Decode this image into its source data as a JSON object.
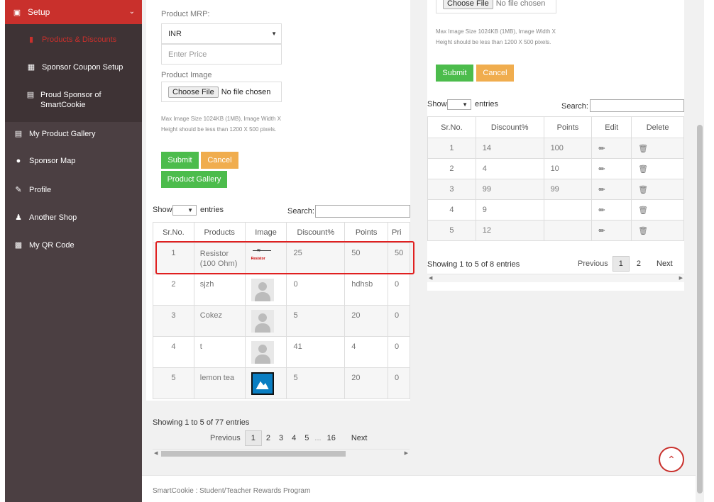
{
  "sidebar": {
    "setup": {
      "label": "Setup",
      "icon": "monitor-icon"
    },
    "submenu": [
      {
        "label": "Products & Discounts",
        "icon": "gift-icon",
        "active": true
      },
      {
        "label": "Sponsor Coupon Setup",
        "icon": "grid-icon",
        "active": false
      },
      {
        "label": "Proud Sponsor of SmartCookie",
        "icon": "picture-icon",
        "active": false
      }
    ],
    "items": [
      {
        "label": "My Product Gallery",
        "icon": "picture-icon"
      },
      {
        "label": "Sponsor Map",
        "icon": "map-marker-icon"
      },
      {
        "label": "Profile",
        "icon": "edit-icon"
      },
      {
        "label": "Another Shop",
        "icon": "users-icon"
      },
      {
        "label": "My QR Code",
        "icon": "qrcode-icon"
      }
    ]
  },
  "product_form": {
    "mrp_label": "Product MRP:",
    "currency": "INR",
    "price_placeholder": "Enter Price",
    "image_label": "Product Image",
    "choose_file": "Choose File",
    "no_file": "No file chosen",
    "hint": "Max Image Size 1024KB (1MB), Image Width X Height should be less than 1200 X 500 pixels.",
    "submit": "Submit",
    "cancel": "Cancel",
    "gallery": "Product Gallery"
  },
  "products_table": {
    "show": "Show",
    "entries": "entries",
    "search": "Search:",
    "columns": [
      "Sr.No.",
      "Products",
      "Image",
      "Discount%",
      "Points",
      "Pri"
    ],
    "rows": [
      {
        "sr": "1",
        "product": "Resistor (100 Ohm)",
        "image": "resistor",
        "image_caption": "Resistor",
        "discount": "25",
        "points": "50",
        "price": "50"
      },
      {
        "sr": "2",
        "product": "sjzh",
        "image": "placeholder",
        "discount": "0",
        "points": "hdhsb",
        "price": "0"
      },
      {
        "sr": "3",
        "product": "Cokez",
        "image": "placeholder",
        "discount": "5",
        "points": "20",
        "price": "0"
      },
      {
        "sr": "4",
        "product": "t",
        "image": "placeholder",
        "discount": "41",
        "points": "4",
        "price": "0"
      },
      {
        "sr": "5",
        "product": "lemon tea",
        "image": "tea",
        "discount": "5",
        "points": "20",
        "price": "0"
      }
    ],
    "info": "Showing 1 to 5 of 77 entries",
    "pagination": {
      "previous": "Previous",
      "pages": [
        "1",
        "2",
        "3",
        "4",
        "5"
      ],
      "ellipsis": "...",
      "last": "16",
      "next": "Next"
    }
  },
  "coupon_form": {
    "choose_file": "Choose File",
    "no_file": "No file chosen",
    "hint": "Max Image Size 1024KB (1MB), Image Width X Height should be less than 1200 X 500 pixels.",
    "submit": "Submit",
    "cancel": "Cancel"
  },
  "discount_table": {
    "show": "Show",
    "entries": "entries",
    "search": "Search:",
    "columns": [
      "Sr.No.",
      "Discount%",
      "Points",
      "Edit",
      "Delete"
    ],
    "rows": [
      {
        "sr": "1",
        "discount": "14",
        "points": "100"
      },
      {
        "sr": "2",
        "discount": "4",
        "points": "10"
      },
      {
        "sr": "3",
        "discount": "99",
        "points": "99"
      },
      {
        "sr": "4",
        "discount": "9",
        "points": ""
      },
      {
        "sr": "5",
        "discount": "12",
        "points": ""
      }
    ],
    "info": "Showing 1 to 5 of 8 entries",
    "pagination": {
      "previous": "Previous",
      "pages": [
        "1",
        "2"
      ],
      "next": "Next"
    }
  },
  "footer": {
    "text": "SmartCookie : Student/Teacher Rewards Program"
  },
  "colors": {
    "sidebar": "#4b3f42",
    "accent": "#c9302c",
    "green": "#4cbc4c",
    "orange": "#f0ad4e"
  }
}
